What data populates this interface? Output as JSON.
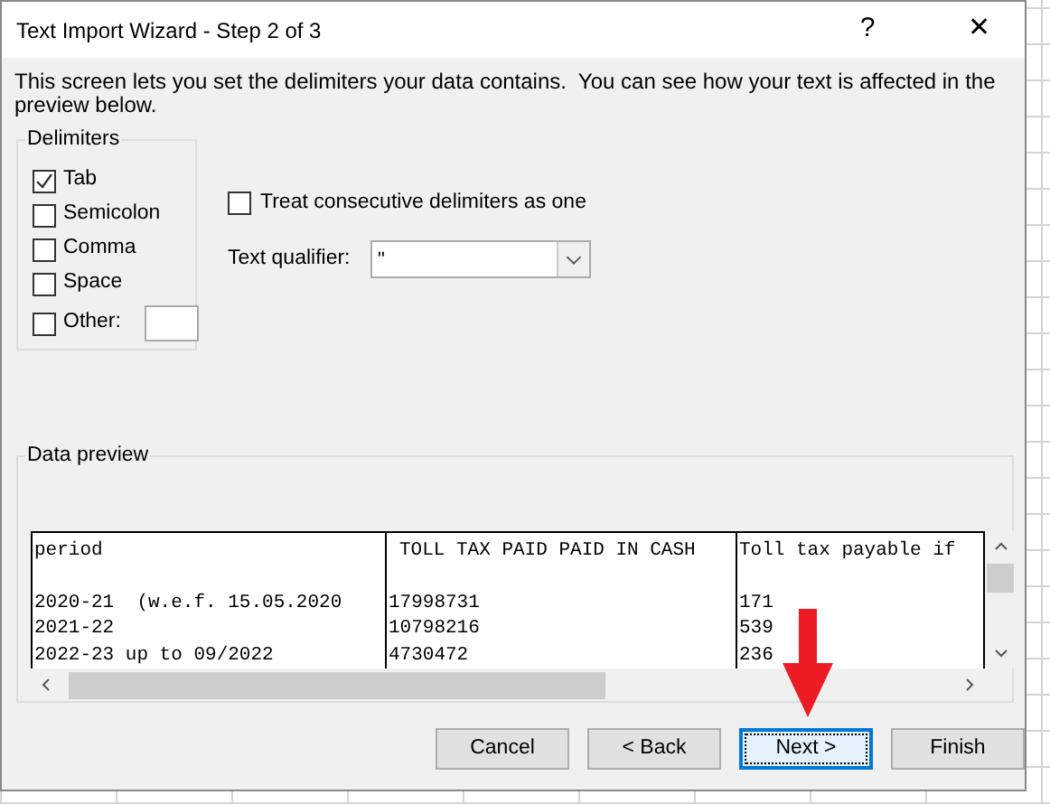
{
  "window": {
    "title": "Text Import Wizard - Step 2 of 3",
    "help": "?",
    "close": "✕"
  },
  "description": "This screen lets you set the delimiters your data contains.  You can see how your text is affected in the preview below.",
  "delimiters": {
    "title": "Delimiters",
    "items": [
      {
        "label": "Tab",
        "checked": true,
        "kind": "plain"
      },
      {
        "label": "Semicolon",
        "checked": false,
        "kind": "plain"
      },
      {
        "label": "Comma",
        "checked": false,
        "kind": "plain"
      },
      {
        "label": "Space",
        "checked": false,
        "kind": "plain"
      },
      {
        "label": "Other:",
        "checked": false,
        "kind": "other"
      }
    ]
  },
  "consecutive": {
    "label": "Treat consecutive delimiters as one",
    "checked": false
  },
  "qualifier": {
    "label": "Text qualifier:",
    "value": "\""
  },
  "preview": {
    "title": "Data preview",
    "header": [
      "period",
      "TOLL TAX PAID PAID IN CASH",
      "Toll tax payable if"
    ],
    "rows": [
      [
        "2020-21  (w.e.f. 15.05.2020",
        "17998731",
        "171"
      ],
      [
        "2021-22",
        "10798216",
        "539"
      ],
      [
        "2022-23 up to 09/2022",
        "4730472",
        "236"
      ]
    ]
  },
  "buttons": [
    {
      "label": "Cancel",
      "default": false
    },
    {
      "label": "< Back",
      "default": false
    },
    {
      "label": "Next >",
      "default": true
    },
    {
      "label": "Finish",
      "default": false
    }
  ]
}
